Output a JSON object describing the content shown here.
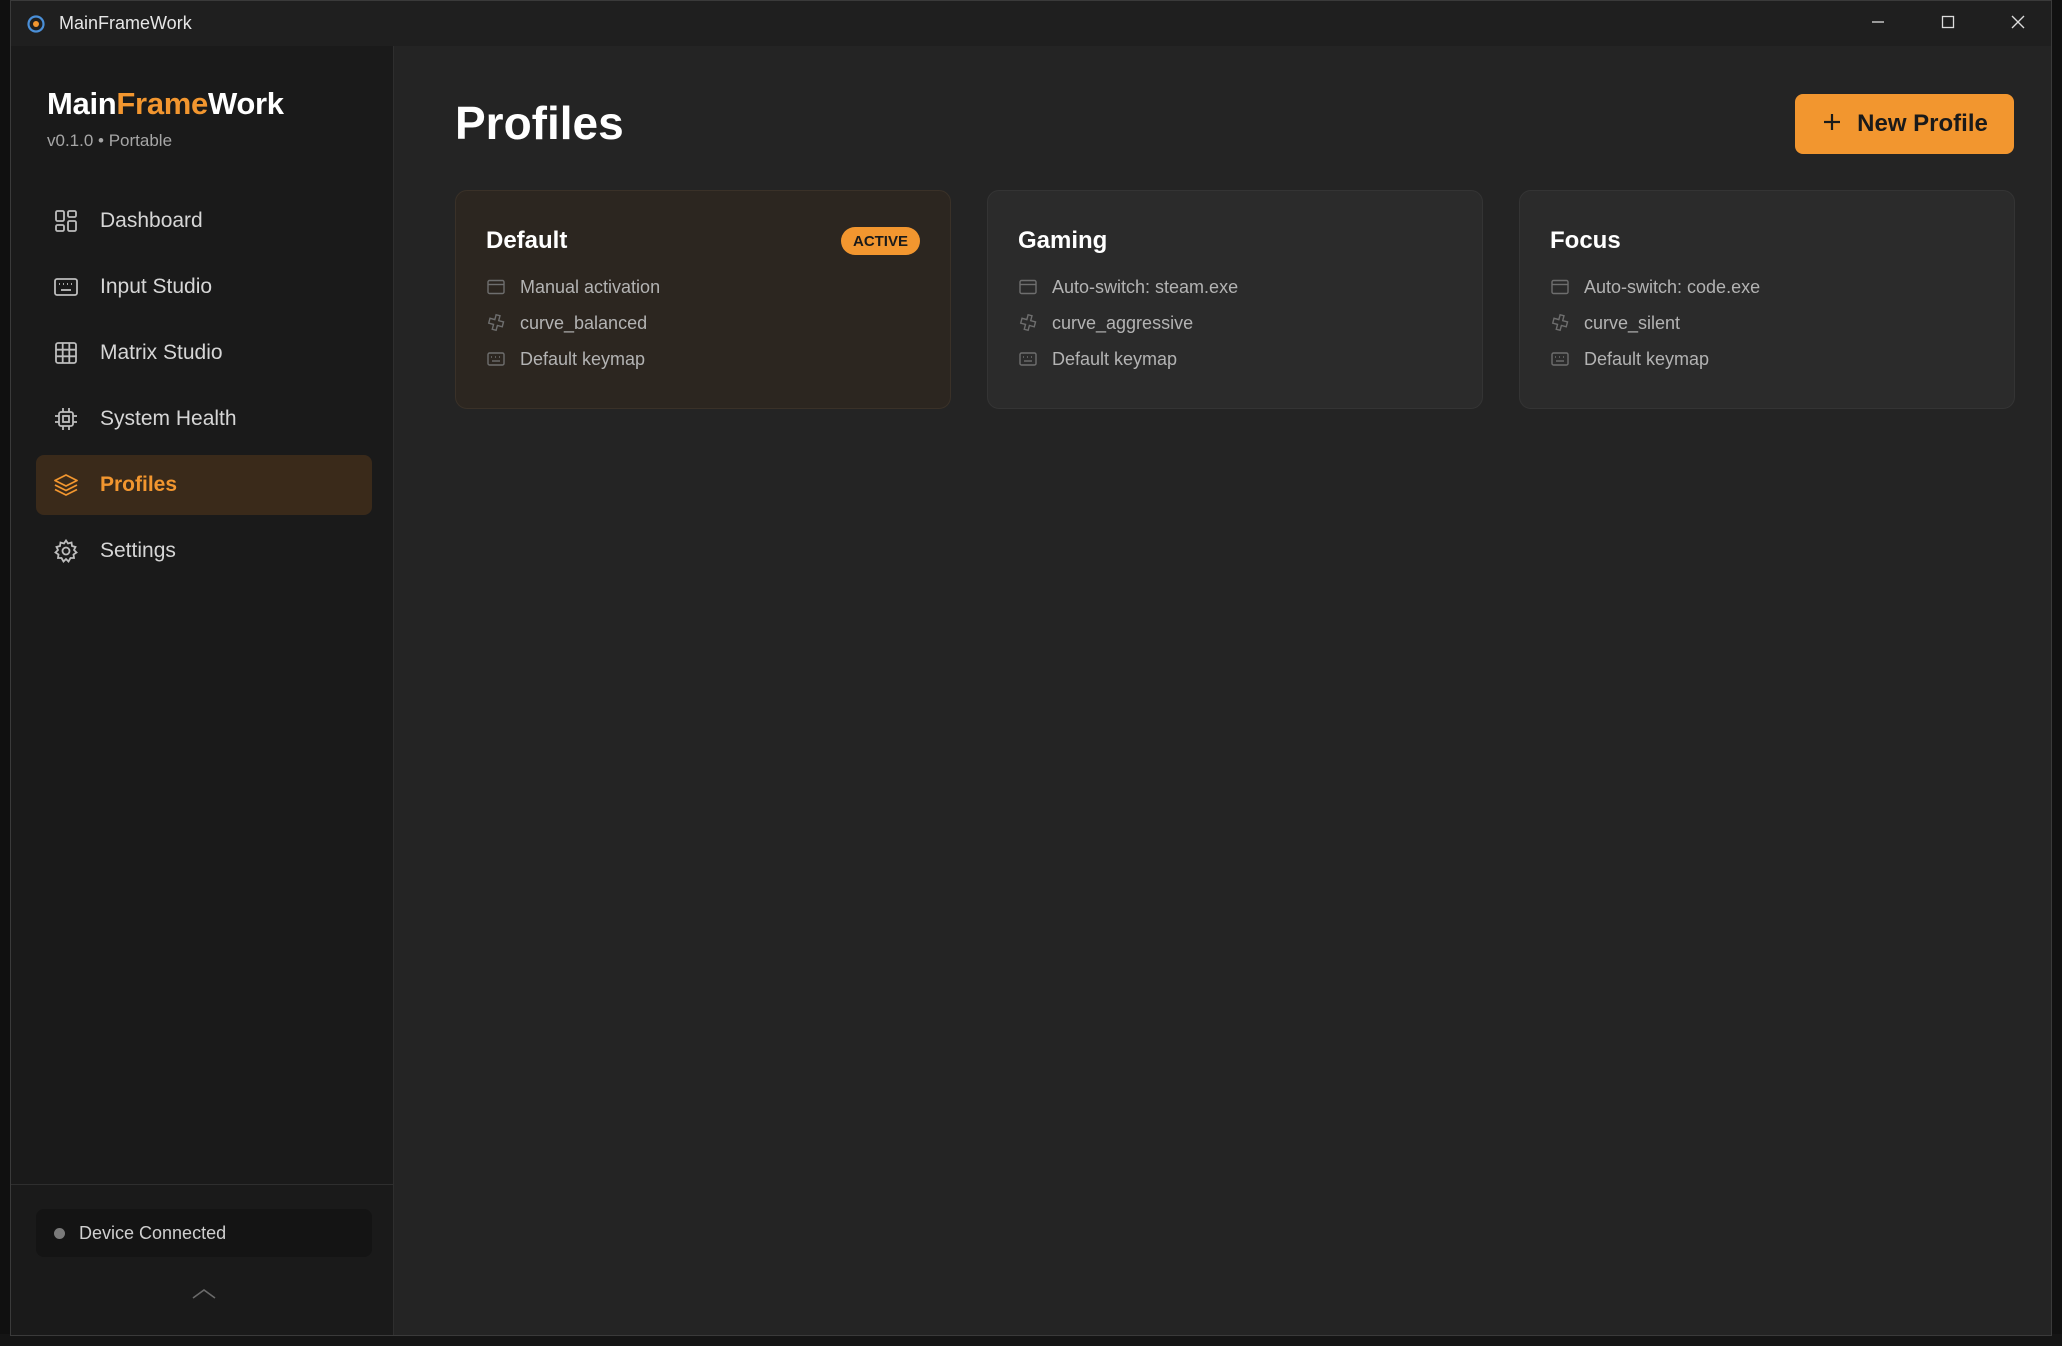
{
  "window": {
    "title": "MainFrameWork",
    "controls": {
      "minimize_icon": "minimize-icon",
      "maximize_icon": "maximize-icon",
      "close_icon": "close-icon"
    }
  },
  "brand": {
    "part1": "Main",
    "part2": "Frame",
    "part3": "Work",
    "version": "v0.1.0 • Portable"
  },
  "colors": {
    "accent": "#f2962f",
    "background": "#242424",
    "sidebar": "#1a1a1a",
    "card": "#2b2b2b"
  },
  "sidebar": {
    "items": [
      {
        "label": "Dashboard",
        "icon": "dashboard-icon",
        "active": false
      },
      {
        "label": "Input Studio",
        "icon": "keyboard-icon",
        "active": false
      },
      {
        "label": "Matrix Studio",
        "icon": "grid-icon",
        "active": false
      },
      {
        "label": "System Health",
        "icon": "cpu-icon",
        "active": false
      },
      {
        "label": "Profiles",
        "icon": "layers-icon",
        "active": true
      },
      {
        "label": "Settings",
        "icon": "gear-icon",
        "active": false
      }
    ],
    "device_status": "Device Connected"
  },
  "main": {
    "title": "Profiles",
    "new_profile_label": "New Profile"
  },
  "profiles": [
    {
      "name": "Default",
      "badge": "ACTIVE",
      "activation": "Manual activation",
      "curve": "curve_balanced",
      "keymap": "Default keymap"
    },
    {
      "name": "Gaming",
      "badge": "",
      "activation": "Auto-switch: steam.exe",
      "curve": "curve_aggressive",
      "keymap": "Default keymap"
    },
    {
      "name": "Focus",
      "badge": "",
      "activation": "Auto-switch: code.exe",
      "curve": "curve_silent",
      "keymap": "Default keymap"
    }
  ]
}
